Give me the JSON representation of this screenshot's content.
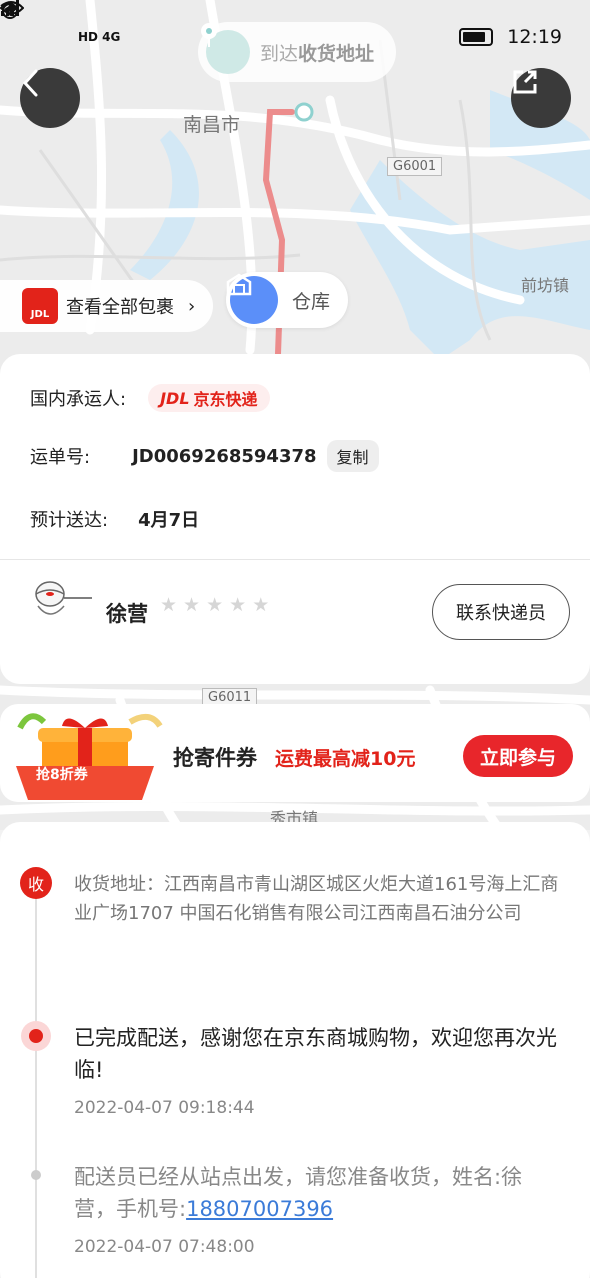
{
  "status_bar": {
    "network": "HD 4G",
    "time": "12:19"
  },
  "map": {
    "destination_prefix": "到达",
    "destination_label": "收货地址",
    "city_label": "南昌市",
    "town_label_1": "前坊镇",
    "town_label_2": "秀市镇",
    "road_tag_1": "G6001",
    "road_tag_2": "G6011",
    "view_all_packages": "查看全部包裹",
    "view_all_chevron": "›",
    "jdl_badge": "JDL",
    "warehouse_label": "仓库"
  },
  "shipment": {
    "carrier_label": "国内承运人:",
    "carrier_logo_text": "JDL",
    "carrier_name": "京东快递",
    "waybill_label": "运单号:",
    "waybill_number": "JD0069268594378",
    "copy_label": "复制",
    "eta_label": "预计送达:",
    "eta_value": "4月7日"
  },
  "courier": {
    "name": "徐营",
    "rating": 0,
    "contact_label": "联系快递员"
  },
  "promo": {
    "badge_text": "抢8折券",
    "title": "抢寄件券",
    "subtitle": "运费最高减10元",
    "cta": "立即参与"
  },
  "tracking": {
    "recv_badge": "收",
    "address": "收货地址：江西南昌市青山湖区城区火炬大道161号海上汇商业广场1707 中国石化销售有限公司江西南昌石油分公司",
    "events": [
      {
        "text": "已完成配送，感谢您在京东商城购物，欢迎您再次光临!",
        "time": "2022-04-07 09:18:44"
      },
      {
        "text_prefix": "配送员已经从站点出发，请您准备收货，姓名:徐营，手机号:",
        "phone": "18807007396",
        "time": "2022-04-07 07:48:00"
      }
    ]
  },
  "colors": {
    "brand_red": "#e2231a",
    "route": "#f08a8a",
    "link": "#3b7bd8"
  }
}
